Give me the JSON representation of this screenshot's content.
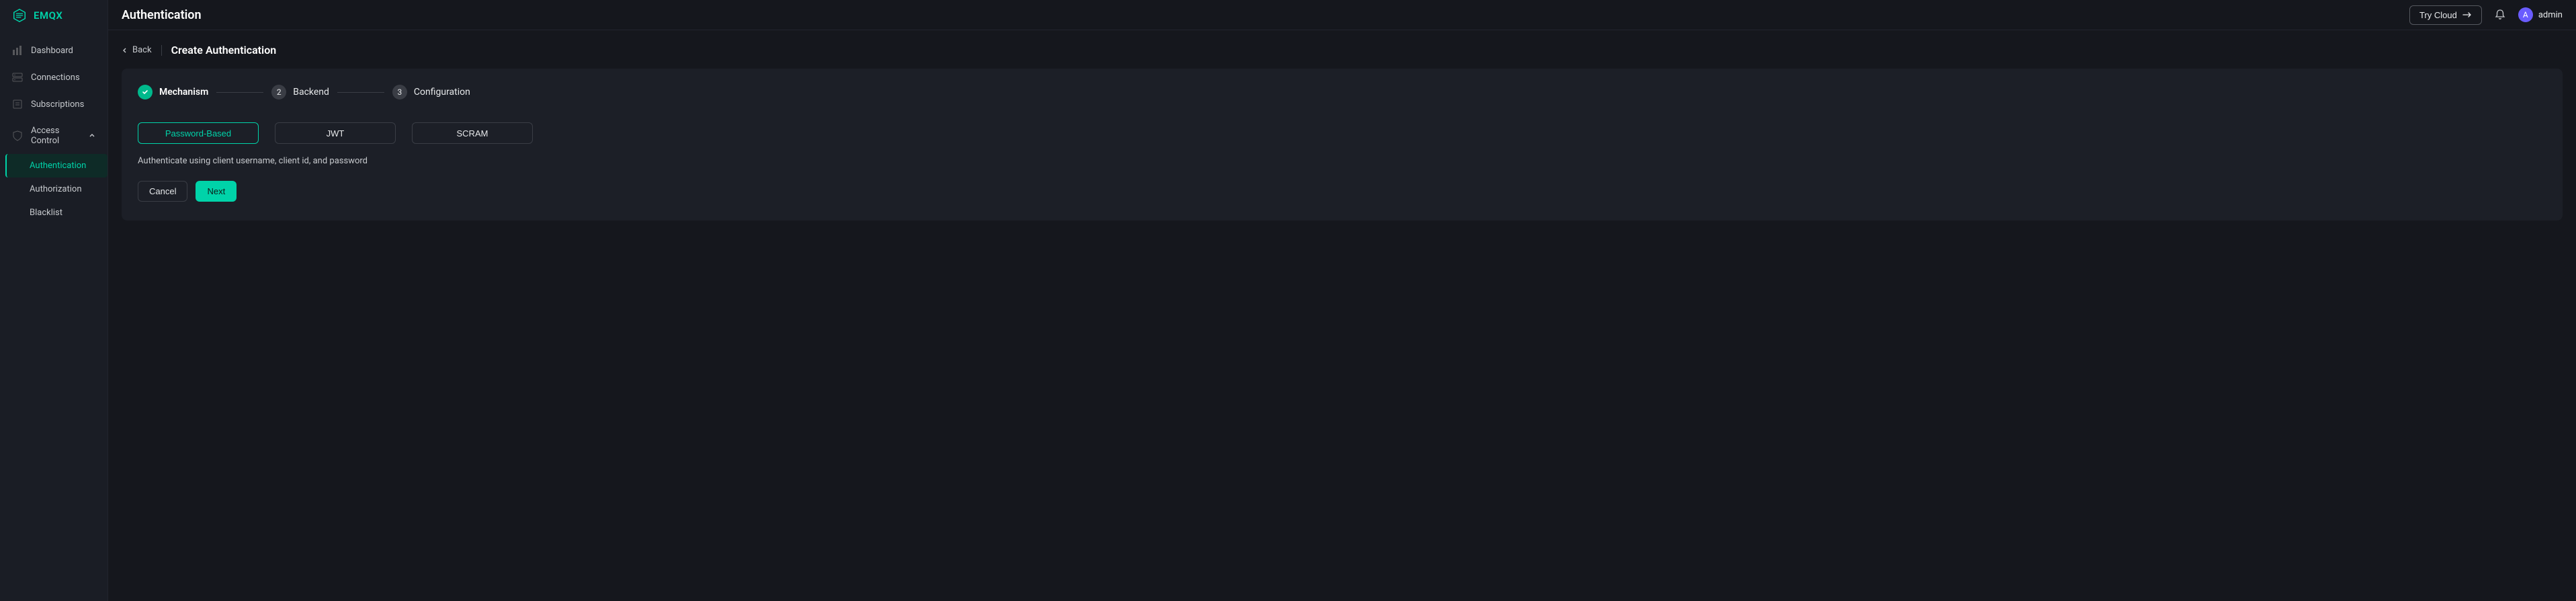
{
  "brand": {
    "name": "EMQX"
  },
  "sidebar": {
    "items": [
      {
        "label": "Dashboard"
      },
      {
        "label": "Connections"
      },
      {
        "label": "Subscriptions"
      },
      {
        "label": "Access Control"
      }
    ],
    "access_control_children": [
      {
        "label": "Authentication"
      },
      {
        "label": "Authorization"
      },
      {
        "label": "Blacklist"
      }
    ]
  },
  "header": {
    "title": "Authentication",
    "try_cloud": "Try Cloud",
    "username": "admin",
    "avatar_initial": "A"
  },
  "breadcrumb": {
    "back": "Back",
    "title": "Create Authentication"
  },
  "stepper": {
    "steps": [
      {
        "label": "Mechanism"
      },
      {
        "label": "Backend",
        "num": "2"
      },
      {
        "label": "Configuration",
        "num": "3"
      }
    ]
  },
  "mechanisms": {
    "options": [
      {
        "label": "Password-Based"
      },
      {
        "label": "JWT"
      },
      {
        "label": "SCRAM"
      }
    ],
    "description": "Authenticate using client username, client id, and password"
  },
  "actions": {
    "cancel": "Cancel",
    "next": "Next"
  },
  "colors": {
    "accent": "#00d3a9",
    "bg": "#15171d",
    "panel": "#1c1f27",
    "sidebar": "#1a1d25",
    "avatar": "#6a5cff"
  }
}
